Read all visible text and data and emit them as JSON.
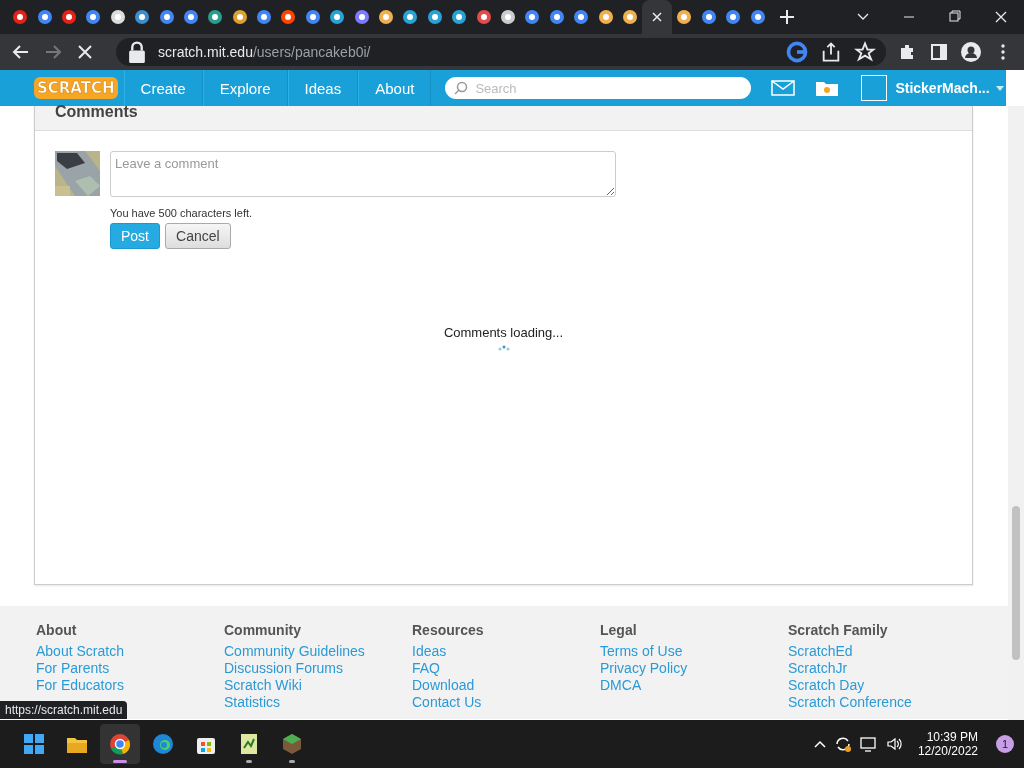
{
  "browser": {
    "tabs": [
      {
        "selected": false
      },
      {
        "selected": false
      },
      {
        "selected": false
      },
      {
        "selected": false
      },
      {
        "selected": false
      },
      {
        "selected": false
      },
      {
        "selected": false
      },
      {
        "selected": false
      },
      {
        "selected": false
      },
      {
        "selected": false
      },
      {
        "selected": false
      },
      {
        "selected": false
      },
      {
        "selected": false
      },
      {
        "selected": false
      },
      {
        "selected": false
      },
      {
        "selected": false
      },
      {
        "selected": false
      },
      {
        "selected": false
      },
      {
        "selected": false
      },
      {
        "selected": false
      },
      {
        "selected": false
      },
      {
        "selected": false
      },
      {
        "selected": false
      },
      {
        "selected": false
      },
      {
        "selected": false
      },
      {
        "selected": false
      },
      {
        "selected": true
      },
      {
        "selected": false
      },
      {
        "selected": false
      },
      {
        "selected": false
      },
      {
        "selected": false
      }
    ],
    "address": {
      "host": "scratch.mit.edu",
      "path": "/users/pancakeb0i/"
    }
  },
  "nav": {
    "logo": "SCRATCH",
    "items": [
      "Create",
      "Explore",
      "Ideas",
      "About"
    ],
    "search": {
      "placeholder": "Search"
    },
    "username": "StickerMach..."
  },
  "comments": {
    "title": "Comments",
    "placeholder": "Leave a comment",
    "chars_left": "You have 500 characters left.",
    "buttons": [
      "Post",
      "Cancel"
    ],
    "loading": "Comments loading..."
  },
  "footer": {
    "columns": [
      {
        "title": "About",
        "links": [
          "About Scratch",
          "For Parents",
          "For Educators"
        ]
      },
      {
        "title": "Community",
        "links": [
          "Community Guidelines",
          "Discussion Forums",
          "Scratch Wiki",
          "Statistics"
        ]
      },
      {
        "title": "Resources",
        "links": [
          "Ideas",
          "FAQ",
          "Download",
          "Contact Us"
        ]
      },
      {
        "title": "Legal",
        "links": [
          "Terms of Use",
          "Privacy Policy",
          "DMCA"
        ]
      },
      {
        "title": "Scratch Family",
        "links": [
          "ScratchEd",
          "ScratchJr",
          "Scratch Day",
          "Scratch Conference"
        ]
      }
    ]
  },
  "status_tooltip": "https://scratch.mit.edu",
  "taskbar": {
    "apps": [
      {
        "selected": false,
        "running": false
      },
      {
        "selected": false,
        "running": false
      },
      {
        "selected": true,
        "running": true
      },
      {
        "selected": false,
        "running": false
      },
      {
        "selected": false,
        "running": false
      },
      {
        "selected": false,
        "running": true
      },
      {
        "selected": false,
        "running": true
      }
    ],
    "time": "10:39 PM",
    "date": "12/20/2022",
    "notifications": "1"
  }
}
